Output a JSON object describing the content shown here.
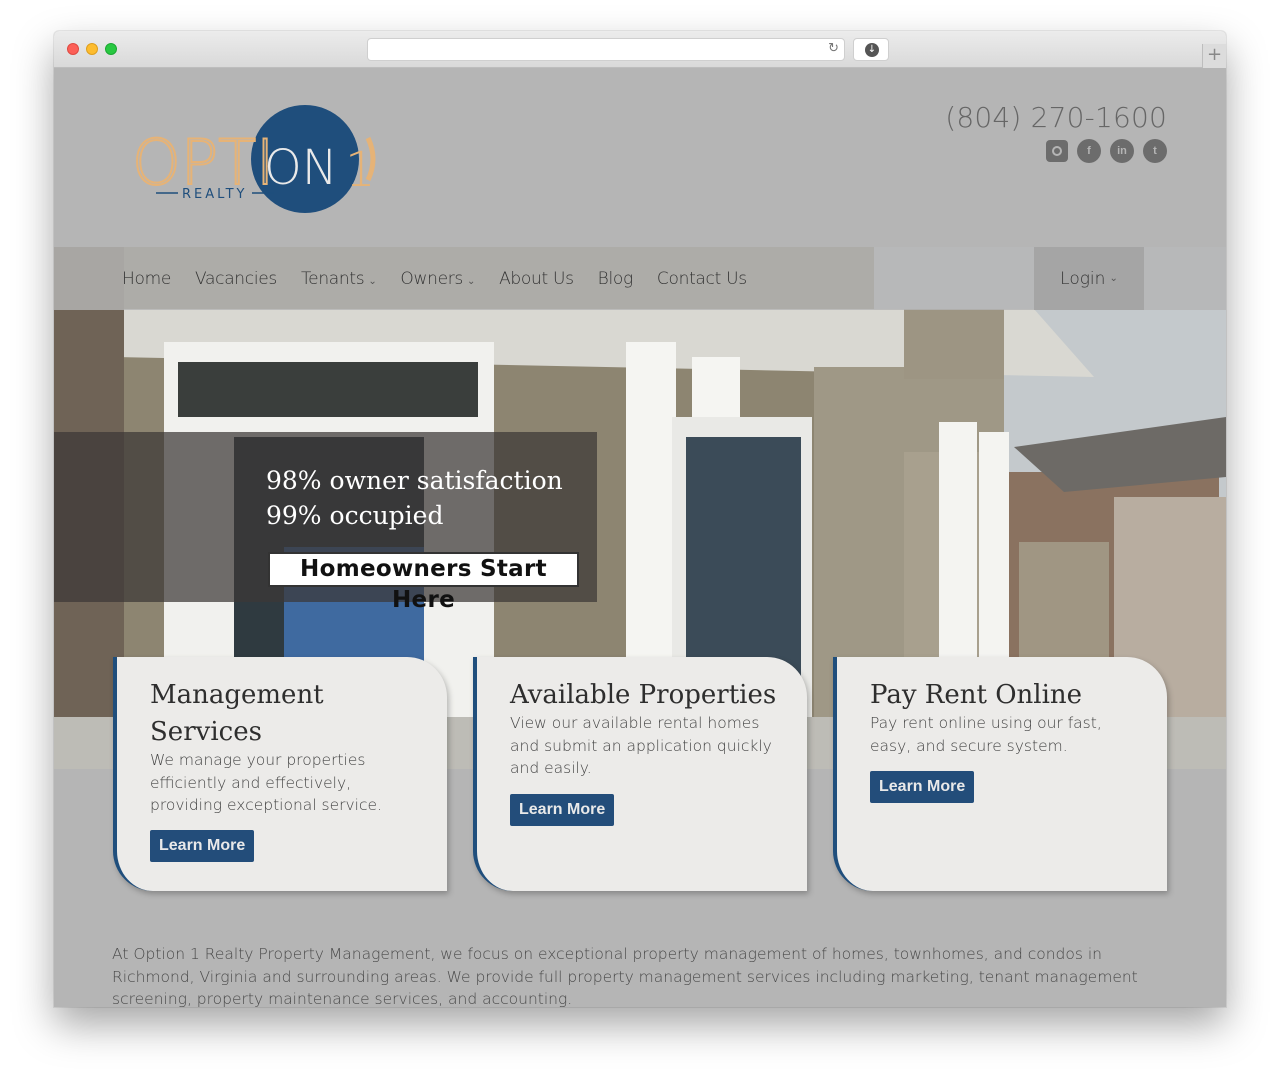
{
  "browser": {
    "url": "",
    "reload_icon": "↻",
    "download_icon": "↓",
    "new_tab_icon": "+"
  },
  "header": {
    "logo": {
      "word_left": "OPTI",
      "word_right": "ON",
      "numeral": "1",
      "tagline": "REALTY",
      "colors": {
        "gold": "#e6b377",
        "blue": "#1f4e7c"
      }
    },
    "phone": "(804) 270-1600",
    "socials": [
      {
        "icon": "instagram-icon",
        "glyph": ""
      },
      {
        "icon": "facebook-icon",
        "glyph": "f"
      },
      {
        "icon": "linkedin-icon",
        "glyph": "in"
      },
      {
        "icon": "twitter-icon",
        "glyph": "t"
      }
    ]
  },
  "nav": {
    "items": [
      {
        "label": "Home",
        "dropdown": false
      },
      {
        "label": "Vacancies",
        "dropdown": false
      },
      {
        "label": "Tenants",
        "dropdown": true
      },
      {
        "label": "Owners",
        "dropdown": true
      },
      {
        "label": "About Us",
        "dropdown": false
      },
      {
        "label": "Blog",
        "dropdown": false
      },
      {
        "label": "Contact Us",
        "dropdown": false
      }
    ],
    "login": "Login",
    "caret": "⌄"
  },
  "promo": {
    "line1": "98% owner satisfaction",
    "line2": "99% occupied",
    "button": "Homeowners Start Here"
  },
  "cards": [
    {
      "title": "Management Services",
      "description": "We manage your properties efficiently and effectively, providing exceptional service.",
      "button": "Learn More"
    },
    {
      "title": "Available Properties",
      "description": "View our available rental homes and submit an application quickly and easily.",
      "button": "Learn More"
    },
    {
      "title": "Pay Rent Online",
      "description": "Pay rent online using our fast, easy, and secure system.",
      "button": "Learn More"
    }
  ],
  "about": "At Option 1 Realty Property Management, we focus on exceptional property management of homes, townhomes, and condos in Richmond, Virginia and surrounding areas. We provide full property management services including marketing, tenant management screening, property maintenance services, and accounting.",
  "colors": {
    "accent": "#234d7a",
    "card_bg": "#ecebe9",
    "page_bg": "#b5b5b5"
  }
}
